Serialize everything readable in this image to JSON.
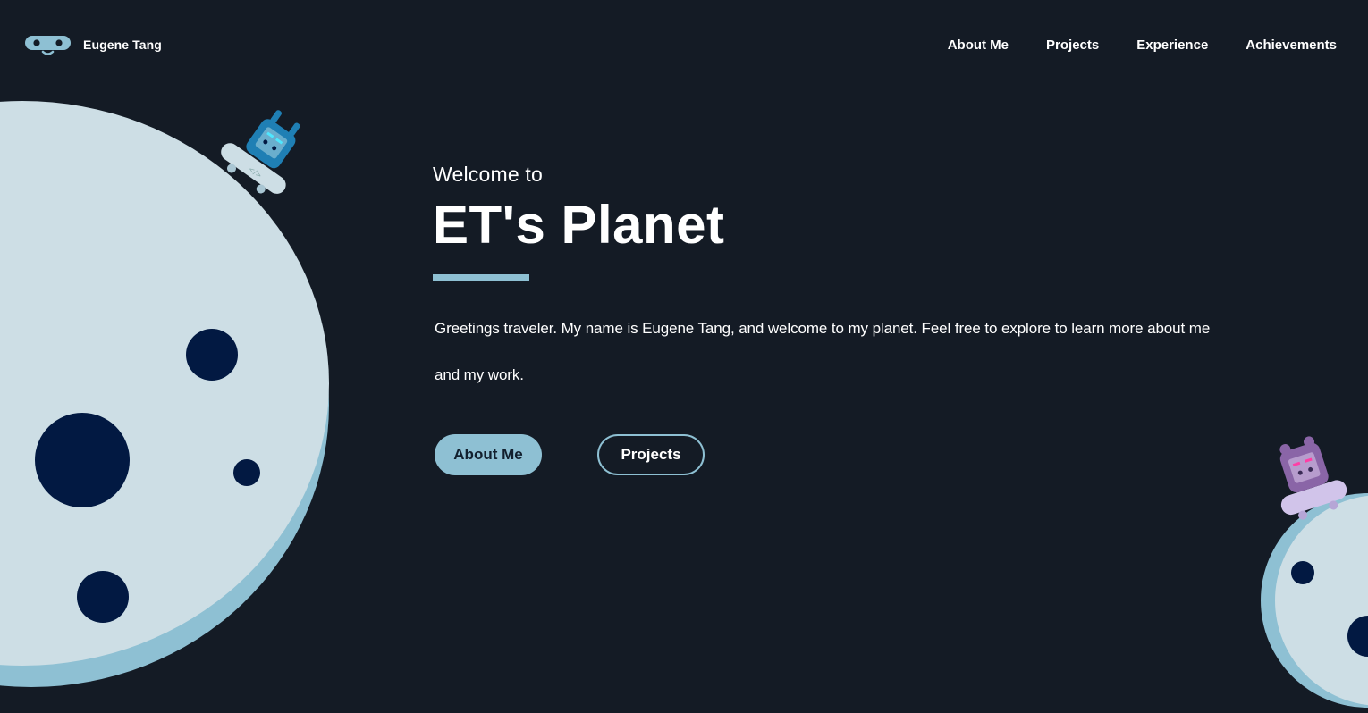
{
  "header": {
    "logo_name": "Eugene Tang",
    "nav": [
      {
        "label": "About Me"
      },
      {
        "label": "Projects"
      },
      {
        "label": "Experience"
      },
      {
        "label": "Achievements"
      }
    ]
  },
  "hero": {
    "welcome": "Welcome to",
    "title": "ET's Planet",
    "intro": "Greetings traveler. My name is Eugene Tang, and welcome to my planet. Feel free to explore to learn more about me and my work.",
    "primary_button": "About Me",
    "secondary_button": "Projects"
  },
  "colors": {
    "background": "#141b25",
    "planet": "#cddee5",
    "planet_rim": "#8ec0d3",
    "crater": "#021942",
    "accent": "#8ec0d3",
    "robot_blue": "#1f7fb4",
    "robot_purple": "#8a65a7",
    "board_purple": "#d1c4ea"
  },
  "icons": {
    "logo": "robot-face-icon"
  }
}
